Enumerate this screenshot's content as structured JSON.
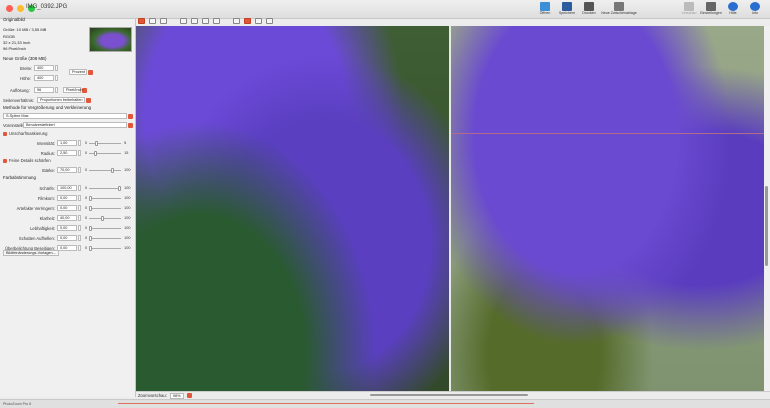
{
  "window": {
    "title": "IMG_0392.JPG"
  },
  "toolbar": {
    "items": [
      {
        "label": "Öffnen"
      },
      {
        "label": "Speichern"
      },
      {
        "label": "Drucken"
      },
      {
        "label": "Neue Zwischenablage"
      },
      {
        "label": "Vorschau"
      },
      {
        "label": "Einstellungen"
      },
      {
        "label": "Hilfe"
      },
      {
        "label": "Info"
      }
    ]
  },
  "sidebar": {
    "original": {
      "header": "Originalbild",
      "size": "Größe: 10 MB / 3,55 MB",
      "mode": "RGGB",
      "dims": "32 x 21,33 Inch",
      "res": "96 Pixel/Inch"
    },
    "new": {
      "header": "Neue Größe (308 MB)",
      "width_label": "Breite:",
      "width_val": "400",
      "height_label": "Höhe:",
      "height_val": "400",
      "unit": "Prozent",
      "res_label": "Auflösung:",
      "res_val": "96",
      "res_unit": "Pixel/Inch"
    },
    "ratio": {
      "label": "Seitenverhältnis:",
      "value": "Proportionen beibehalten"
    },
    "method": {
      "header": "Methode für Vergrößerung und Verkleinerung",
      "value": "S-Spline Max"
    },
    "presets": {
      "label": "Voreinstellungen:",
      "value": "Benutzerdefiniert"
    },
    "unsharp": {
      "label": "Unscharfmaskierung",
      "intensity_label": "Intensität:",
      "intensity_val": "1,00",
      "intensity_max": "5",
      "radius_label": "Radius:",
      "radius_val": "2,50",
      "radius_max": "15"
    },
    "fine": {
      "label": "Feine Details schärfen",
      "strength_label": "Stärke:",
      "strength_val": "70,00",
      "strength_max": "100"
    },
    "color": {
      "header": "Farbabstimmung",
      "rows": [
        {
          "label": "Schärfe:",
          "val": "100,00",
          "max": "100"
        },
        {
          "label": "Filmkorn:",
          "val": "0,00",
          "max": "100"
        },
        {
          "label": "Artefakte Verringern:",
          "val": "0,00",
          "max": "100"
        },
        {
          "label": "Klarheit:",
          "val": "40,00",
          "max": "100"
        },
        {
          "label": "Lebhaftigkeit:",
          "val": "0,00",
          "max": "100"
        },
        {
          "label": "Schatten Aufhellen:",
          "val": "0,00",
          "max": "100"
        },
        {
          "label": "Überbelichtung Beseitigen:",
          "val": "0,00",
          "max": "100"
        }
      ]
    },
    "tpl": "Bildfeinänderungs-Vorlagen..."
  },
  "bottom": {
    "zoom_label": "Zoomvorschau:",
    "zoom_val": "98%"
  },
  "status": {
    "app": "PhotoZoom Pro 8"
  },
  "colors": {
    "accent": "#e2573a"
  }
}
